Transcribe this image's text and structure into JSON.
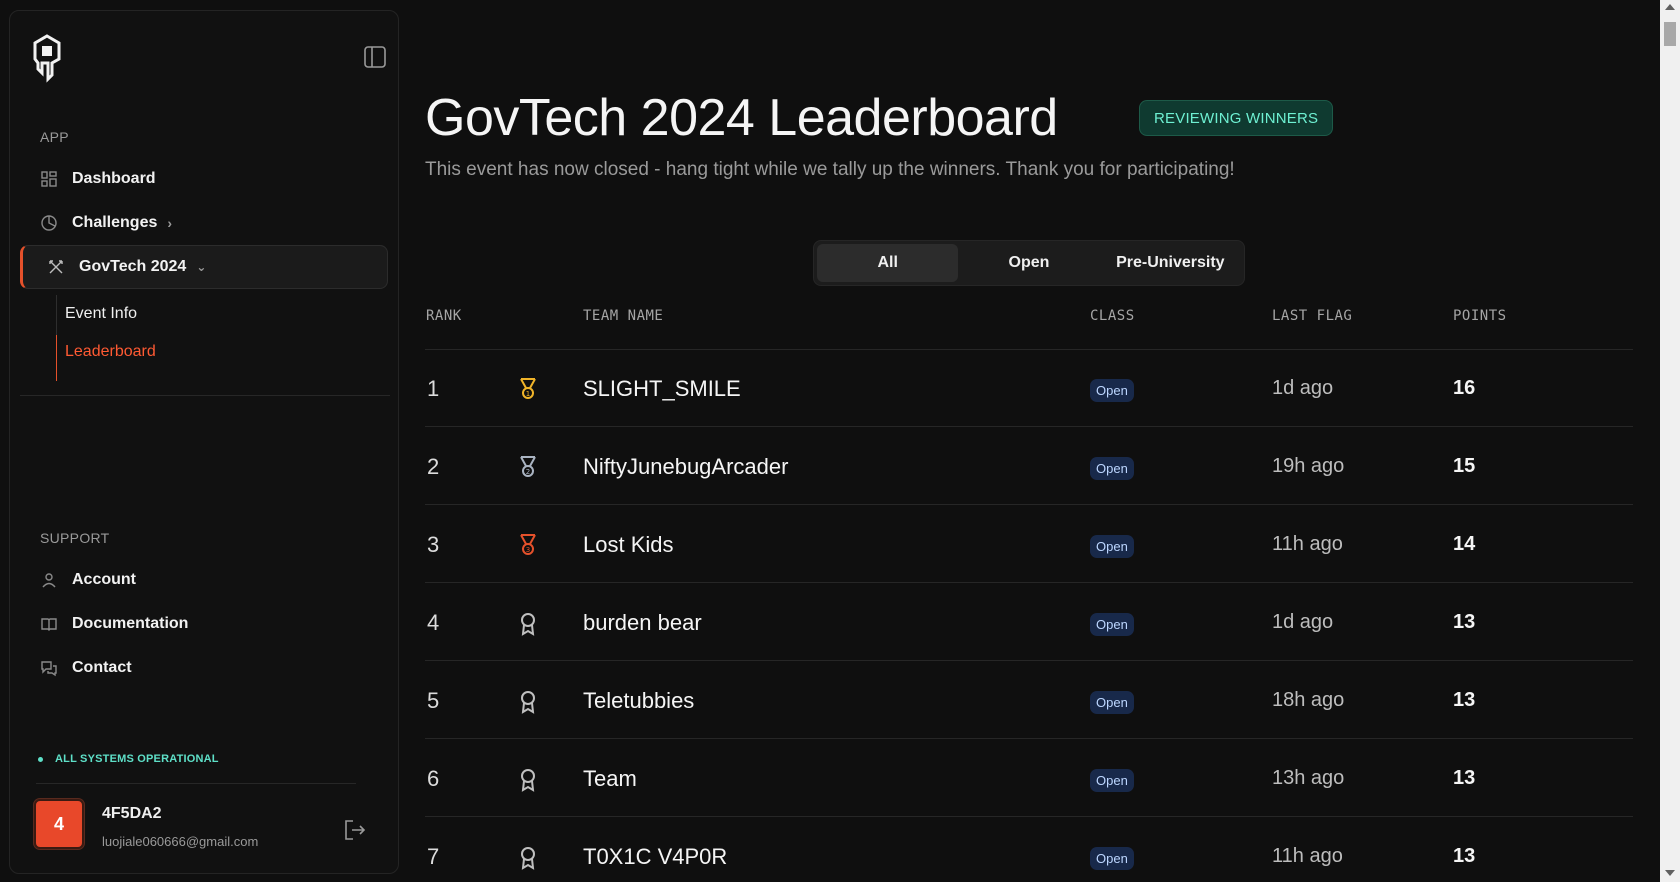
{
  "sidebar": {
    "app_label": "APP",
    "support_label": "SUPPORT",
    "nav": {
      "dashboard": "Dashboard",
      "challenges": "Challenges",
      "event": "GovTech 2024"
    },
    "sub": {
      "event_info": "Event Info",
      "leaderboard": "Leaderboard"
    },
    "support": {
      "account": "Account",
      "documentation": "Documentation",
      "contact": "Contact"
    },
    "status": "ALL SYSTEMS OPERATIONAL",
    "user": {
      "avatar": "4",
      "name": "4F5DA2",
      "email": "luojiale060666@gmail.com"
    }
  },
  "main": {
    "title": "GovTech 2024 Leaderboard",
    "badge": "REVIEWING WINNERS",
    "subtitle": "This event has now closed - hang tight while we tally up the winners. Thank you for participating!",
    "tabs": [
      "All",
      "Open",
      "Pre-University"
    ],
    "active_tab": "All",
    "columns": {
      "rank": "RANK",
      "team": "TEAM NAME",
      "class": "CLASS",
      "last_flag": "LAST FLAG",
      "points": "POINTS"
    },
    "rows": [
      {
        "rank": "1",
        "medal": "gold",
        "team": "SLIGHT_SMILE",
        "class": "Open",
        "last_flag": "1d ago",
        "points": "16"
      },
      {
        "rank": "2",
        "medal": "silver",
        "team": "NiftyJunebugArcader",
        "class": "Open",
        "last_flag": "19h ago",
        "points": "15"
      },
      {
        "rank": "3",
        "medal": "bronze",
        "team": "Lost Kids",
        "class": "Open",
        "last_flag": "11h ago",
        "points": "14"
      },
      {
        "rank": "4",
        "medal": "none",
        "team": "burden bear",
        "class": "Open",
        "last_flag": "1d ago",
        "points": "13"
      },
      {
        "rank": "5",
        "medal": "none",
        "team": "Teletubbies",
        "class": "Open",
        "last_flag": "18h ago",
        "points": "13"
      },
      {
        "rank": "6",
        "medal": "none",
        "team": "Team",
        "class": "Open",
        "last_flag": "13h ago",
        "points": "13"
      },
      {
        "rank": "7",
        "medal": "none",
        "team": "T0X1C V4P0R",
        "class": "Open",
        "last_flag": "11h ago",
        "points": "13"
      }
    ]
  },
  "colors": {
    "accent": "#e5512b",
    "gold": "#f0b429",
    "silver": "#aab4c2",
    "bronze": "#e5512b",
    "plain": "#bfbfbf",
    "status": "#5ee0c8"
  }
}
